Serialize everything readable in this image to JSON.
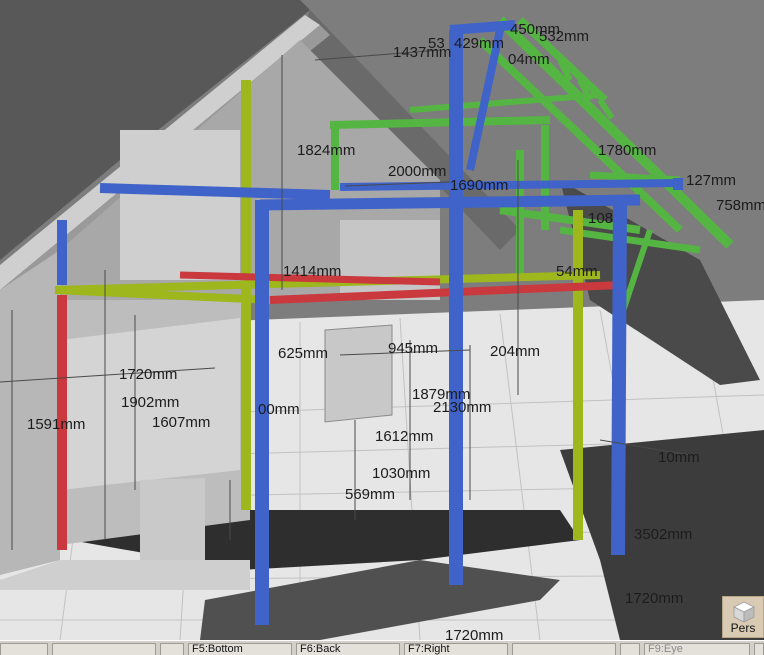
{
  "viewport": {
    "dimensions": [
      {
        "id": "d1",
        "text": "53"
      },
      {
        "id": "d2",
        "text": "429mm"
      },
      {
        "id": "d3",
        "text": "450mm"
      },
      {
        "id": "d4",
        "text": "532mm"
      },
      {
        "id": "d5",
        "text": "1437mm"
      },
      {
        "id": "d6",
        "text": "04mm"
      },
      {
        "id": "d7",
        "text": "1824mm"
      },
      {
        "id": "d8",
        "text": "1780mm"
      },
      {
        "id": "d9",
        "text": "2000mm"
      },
      {
        "id": "d10",
        "text": "1690mm"
      },
      {
        "id": "d11",
        "text": "127mm"
      },
      {
        "id": "d12",
        "text": "758mm"
      },
      {
        "id": "d13",
        "text": "108"
      },
      {
        "id": "d14",
        "text": "1414mm"
      },
      {
        "id": "d15",
        "text": "54mm"
      },
      {
        "id": "d16",
        "text": "625mm"
      },
      {
        "id": "d17",
        "text": "945mm"
      },
      {
        "id": "d18",
        "text": "204mm"
      },
      {
        "id": "d19",
        "text": "1720mm"
      },
      {
        "id": "d20",
        "text": "1902mm"
      },
      {
        "id": "d21",
        "text": "1591mm"
      },
      {
        "id": "d22",
        "text": "1607mm"
      },
      {
        "id": "d23",
        "text": "00mm"
      },
      {
        "id": "d24",
        "text": "1879mm"
      },
      {
        "id": "d25",
        "text": "2130mm"
      },
      {
        "id": "d26",
        "text": "1612mm"
      },
      {
        "id": "d27",
        "text": "10mm"
      },
      {
        "id": "d28",
        "text": "1030mm"
      },
      {
        "id": "d29",
        "text": "569mm"
      },
      {
        "id": "d30",
        "text": "3502mm"
      },
      {
        "id": "d31",
        "text": "1720mm"
      },
      {
        "id": "d32",
        "text": "1720mm"
      }
    ],
    "view_cube": {
      "label": "Pers",
      "icon": "cube-icon"
    }
  },
  "statusbar": {
    "keys": [
      {
        "id": "k1",
        "label": ""
      },
      {
        "id": "k2",
        "label": ""
      },
      {
        "id": "k3",
        "label": ""
      },
      {
        "id": "k4",
        "label": "F5:Bottom"
      },
      {
        "id": "k5",
        "label": "F6:Back"
      },
      {
        "id": "k6",
        "label": "F7:Right"
      },
      {
        "id": "k7",
        "label": ""
      },
      {
        "id": "k8",
        "label": ""
      },
      {
        "id": "k9",
        "label": "F9:Eye"
      },
      {
        "id": "k10",
        "label": ""
      }
    ]
  },
  "colors": {
    "post_blue": "#3f63c9",
    "beam_green": "#5fc24a",
    "post_olive": "#9bb81a",
    "beam_red": "#c8383c",
    "grid_floor": "#e8e8e8",
    "dark_plate": "#3a3a3a"
  }
}
